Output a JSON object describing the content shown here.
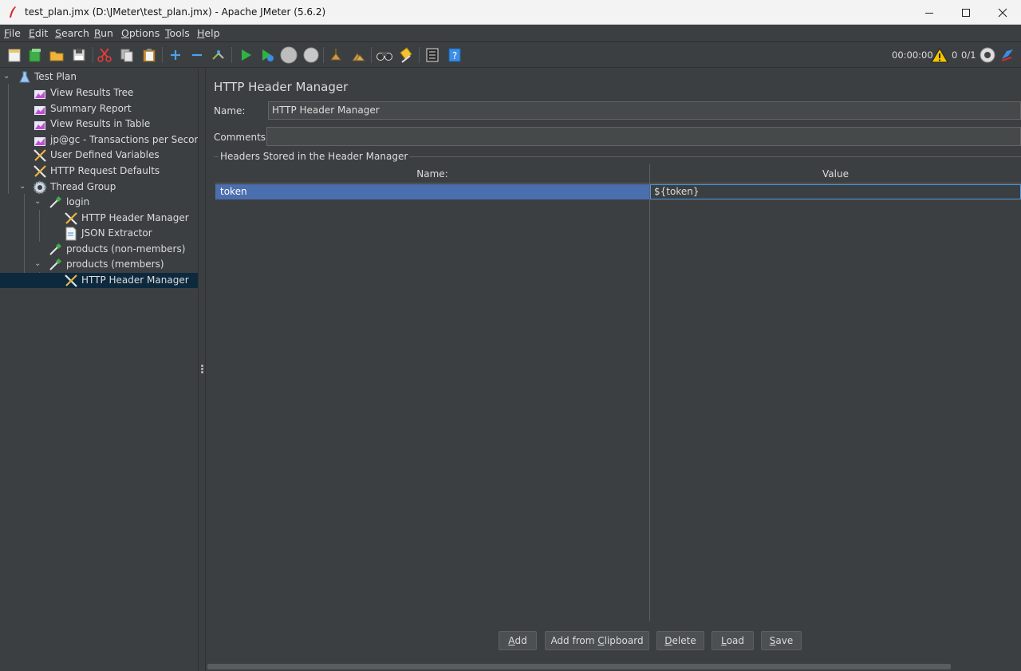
{
  "window": {
    "title": "test_plan.jmx (D:\\JMeter\\test_plan.jmx) - Apache JMeter (5.6.2)"
  },
  "menu": [
    {
      "mn": "F",
      "rest": "ile"
    },
    {
      "mn": "E",
      "rest": "dit"
    },
    {
      "mn": "S",
      "rest": "earch"
    },
    {
      "mn": "R",
      "rest": "un"
    },
    {
      "mn": "O",
      "rest": "ptions"
    },
    {
      "mn": "T",
      "rest": "ools"
    },
    {
      "mn": "H",
      "rest": "elp"
    }
  ],
  "toolbar": {
    "timer": "00:00:00",
    "warnings": "0",
    "threads": "0/1"
  },
  "tree": [
    {
      "label": "Test Plan",
      "icon": "flask-icon"
    },
    {
      "label": "View Results Tree",
      "icon": "chart-icon"
    },
    {
      "label": "Summary Report",
      "icon": "chart-icon"
    },
    {
      "label": "View Results in Table",
      "icon": "chart-icon"
    },
    {
      "label": "jp@gc - Transactions per Second",
      "icon": "chart-icon"
    },
    {
      "label": "User Defined Variables",
      "icon": "tools-icon"
    },
    {
      "label": "HTTP Request Defaults",
      "icon": "tools-icon"
    },
    {
      "label": "Thread Group",
      "icon": "gear-icon"
    },
    {
      "label": "login",
      "icon": "pipette-icon"
    },
    {
      "label": "HTTP Header Manager",
      "icon": "tools-icon"
    },
    {
      "label": "JSON Extractor",
      "icon": "document-icon"
    },
    {
      "label": "products (non-members)",
      "icon": "pipette-icon"
    },
    {
      "label": "products (members)",
      "icon": "pipette-icon"
    },
    {
      "label": "HTTP Header Manager",
      "icon": "tools-icon"
    }
  ],
  "panel": {
    "title": "HTTP Header Manager",
    "name_label": "Name:",
    "name_value": "HTTP Header Manager",
    "comments_label": "Comments:",
    "comments_value": "",
    "group_title": "Headers Stored in the Header Manager",
    "table": {
      "columns": [
        "Name:",
        "Value"
      ],
      "rows": [
        {
          "name": "token",
          "value": "${token}"
        }
      ]
    },
    "buttons": [
      {
        "mn": "A",
        "rest": "dd",
        "pre": ""
      },
      {
        "pre": "Add from ",
        "mn": "C",
        "rest": "lipboard"
      },
      {
        "mn": "D",
        "rest": "elete",
        "pre": ""
      },
      {
        "mn": "L",
        "rest": "oad",
        "pre": ""
      },
      {
        "mn": "S",
        "rest": "ave",
        "pre": ""
      }
    ]
  }
}
